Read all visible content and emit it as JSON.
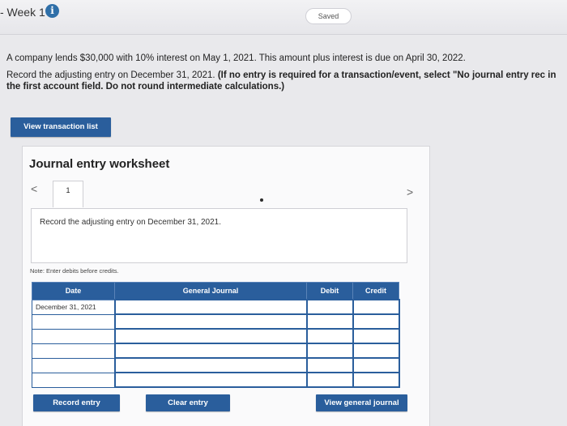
{
  "header": {
    "week_title": "- Week 1",
    "info_glyph": "i",
    "saved_label": "Saved"
  },
  "question": {
    "line1": "A company lends $30,000 with 10% interest on May 1, 2021. This amount plus interest is due on April 30, 2022.",
    "line2_plain": "Record the adjusting entry on December 31, 2021. ",
    "line2_bold": "(If no entry is required for a transaction/event, select \"No journal entry rec in the first account field. Do not round intermediate calculations.)"
  },
  "buttons": {
    "view_transactions": "View transaction list",
    "record_entry": "Record entry",
    "clear_entry": "Clear entry",
    "view_general_journal": "View general journal"
  },
  "worksheet": {
    "title": "Journal entry worksheet",
    "prev_glyph": "<",
    "next_glyph": ">",
    "current_tab": "1",
    "instruction": "Record the adjusting entry on December 31, 2021.",
    "note": "Note: Enter debits before credits."
  },
  "journal_table": {
    "headers": {
      "date": "Date",
      "general_journal": "General Journal",
      "debit": "Debit",
      "credit": "Credit"
    },
    "rows": [
      {
        "date": "December 31, 2021"
      },
      {
        "date": ""
      },
      {
        "date": ""
      },
      {
        "date": ""
      },
      {
        "date": ""
      },
      {
        "date": ""
      }
    ]
  }
}
